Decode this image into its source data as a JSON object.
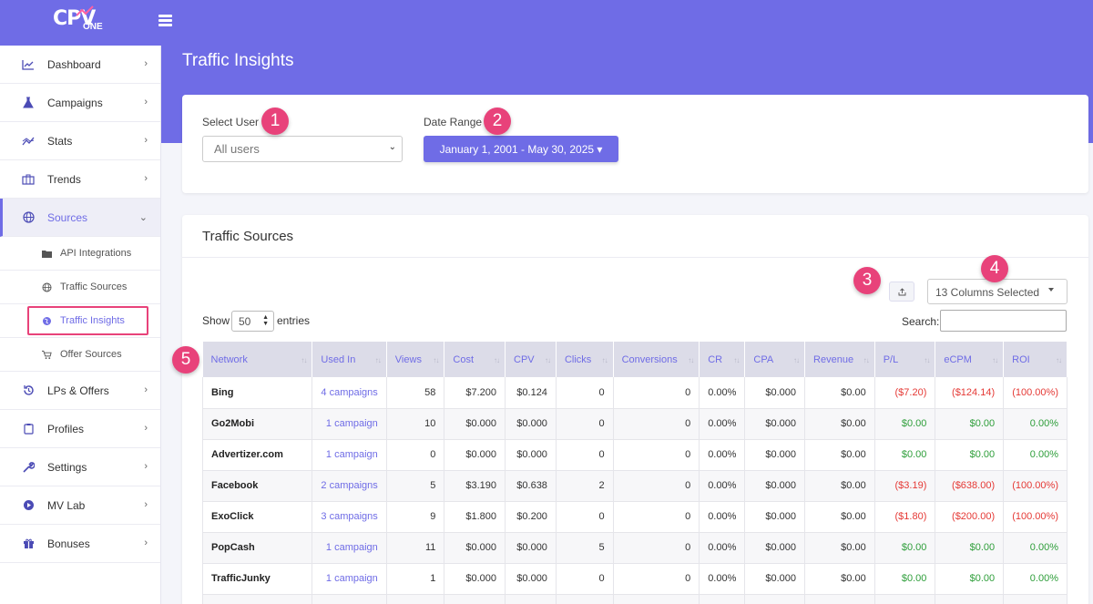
{
  "brand": {
    "logo_text": "CPV",
    "logo_sub": "ONE"
  },
  "page": {
    "title": "Traffic Insights"
  },
  "sidebar": {
    "items": [
      {
        "label": "Dashboard",
        "icon": "line-chart-icon"
      },
      {
        "label": "Campaigns",
        "icon": "flask-icon"
      },
      {
        "label": "Stats",
        "icon": "stats-icon"
      },
      {
        "label": "Trends",
        "icon": "briefcase-icon"
      },
      {
        "label": "Sources",
        "icon": "globe-icon"
      }
    ],
    "sub_items": [
      {
        "label": "API Integrations",
        "icon": "folder-icon"
      },
      {
        "label": "Traffic Sources",
        "icon": "globe-icon"
      },
      {
        "label": "Traffic Insights",
        "icon": "globe-icon"
      },
      {
        "label": "Offer Sources",
        "icon": "cart-icon"
      }
    ],
    "items_after": [
      {
        "label": "LPs & Offers",
        "icon": "history-icon"
      },
      {
        "label": "Profiles",
        "icon": "clipboard-icon"
      },
      {
        "label": "Settings",
        "icon": "wrench-icon"
      },
      {
        "label": "MV Lab",
        "icon": "disc-icon"
      },
      {
        "label": "Bonuses",
        "icon": "gift-icon"
      }
    ]
  },
  "filters": {
    "user_label": "Select User",
    "user_value": "All users",
    "date_label": "Date Range",
    "date_value": "January 1, 2001 - May 30, 2025 ▾"
  },
  "sources": {
    "title": "Traffic Sources",
    "columns_selected": "13 Columns Selected",
    "show_label": "Show",
    "entries_value": "50",
    "entries_label": "entries",
    "search_label": "Search:",
    "columns": [
      "Network",
      "Used In",
      "Views",
      "Cost",
      "CPV",
      "Clicks",
      "Conversions",
      "CR",
      "CPA",
      "Revenue",
      "P/L",
      "eCPM",
      "ROI"
    ],
    "rows": [
      {
        "network": "Bing",
        "used_in": "4 campaigns",
        "views": "58",
        "cost": "$7.200",
        "cpv": "$0.124",
        "clicks": "0",
        "conversions": "0",
        "cr": "0.00%",
        "cpa": "$0.000",
        "revenue": "$0.00",
        "pl": "($7.20)",
        "ecpm": "($124.14)",
        "roi": "(100.00%)",
        "status": "neg"
      },
      {
        "network": "Go2Mobi",
        "used_in": "1 campaign",
        "views": "10",
        "cost": "$0.000",
        "cpv": "$0.000",
        "clicks": "0",
        "conversions": "0",
        "cr": "0.00%",
        "cpa": "$0.000",
        "revenue": "$0.00",
        "pl": "$0.00",
        "ecpm": "$0.00",
        "roi": "0.00%",
        "status": "pos"
      },
      {
        "network": "Advertizer.com",
        "used_in": "1 campaign",
        "views": "0",
        "cost": "$0.000",
        "cpv": "$0.000",
        "clicks": "0",
        "conversions": "0",
        "cr": "0.00%",
        "cpa": "$0.000",
        "revenue": "$0.00",
        "pl": "$0.00",
        "ecpm": "$0.00",
        "roi": "0.00%",
        "status": "pos"
      },
      {
        "network": "Facebook",
        "used_in": "2 campaigns",
        "views": "5",
        "cost": "$3.190",
        "cpv": "$0.638",
        "clicks": "2",
        "conversions": "0",
        "cr": "0.00%",
        "cpa": "$0.000",
        "revenue": "$0.00",
        "pl": "($3.19)",
        "ecpm": "($638.00)",
        "roi": "(100.00%)",
        "status": "neg"
      },
      {
        "network": "ExoClick",
        "used_in": "3 campaigns",
        "views": "9",
        "cost": "$1.800",
        "cpv": "$0.200",
        "clicks": "0",
        "conversions": "0",
        "cr": "0.00%",
        "cpa": "$0.000",
        "revenue": "$0.00",
        "pl": "($1.80)",
        "ecpm": "($200.00)",
        "roi": "(100.00%)",
        "status": "neg"
      },
      {
        "network": "PopCash",
        "used_in": "1 campaign",
        "views": "11",
        "cost": "$0.000",
        "cpv": "$0.000",
        "clicks": "5",
        "conversions": "0",
        "cr": "0.00%",
        "cpa": "$0.000",
        "revenue": "$0.00",
        "pl": "$0.00",
        "ecpm": "$0.00",
        "roi": "0.00%",
        "status": "pos"
      },
      {
        "network": "TrafficJunky",
        "used_in": "1 campaign",
        "views": "1",
        "cost": "$0.000",
        "cpv": "$0.000",
        "clicks": "0",
        "conversions": "0",
        "cr": "0.00%",
        "cpa": "$0.000",
        "revenue": "$0.00",
        "pl": "$0.00",
        "ecpm": "$0.00",
        "roi": "0.00%",
        "status": "pos"
      },
      {
        "network": "",
        "used_in": "",
        "views": "",
        "cost": "",
        "cpv": "",
        "clicks": "",
        "conversions": "",
        "cr": "",
        "cpa": "",
        "revenue": "",
        "pl": "",
        "ecpm": "",
        "roi": "",
        "status": "pos"
      }
    ]
  },
  "annotations": [
    "1",
    "2",
    "3",
    "4",
    "5"
  ],
  "colors": {
    "accent": "#6f6ce6",
    "highlight": "#e8427a",
    "negative": "#e53935",
    "positive": "#2e9e3a"
  }
}
